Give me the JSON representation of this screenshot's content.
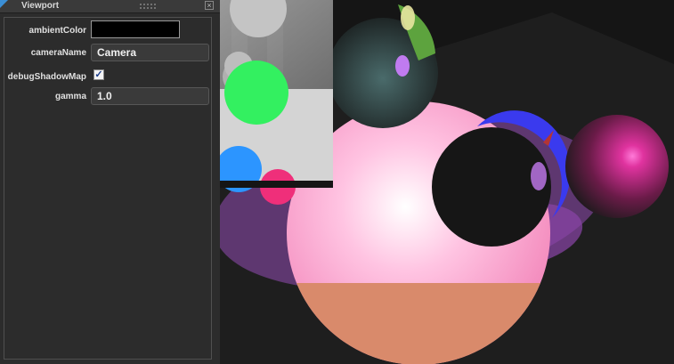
{
  "panel": {
    "title": "Viewport",
    "close_glyph": "×",
    "properties": {
      "ambient_color": {
        "label": "ambientColor",
        "value": "#000000"
      },
      "camera_name": {
        "label": "cameraName",
        "value": "Camera"
      },
      "debug_shadow_map": {
        "label": "debugShadowMap",
        "checked": true,
        "glyph": "✓"
      },
      "gamma": {
        "label": "gamma",
        "value": "1.0"
      }
    }
  }
}
